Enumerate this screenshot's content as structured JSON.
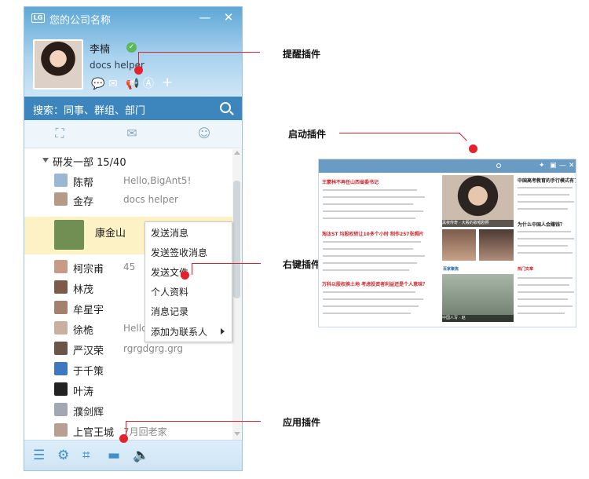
{
  "window": {
    "logo": "LG",
    "title": "您的公司名称",
    "minimize": "—",
    "close": "✕"
  },
  "profile": {
    "name": "李楠",
    "signature": "docs helper",
    "online_check": "✓",
    "icons": [
      "chat-bubble-icon",
      "mail-icon",
      "announce-icon",
      "font-icon",
      "add-icon"
    ]
  },
  "search": {
    "text": "搜索：同事、群组、部门"
  },
  "tabs": [
    {
      "name": "org-chart-icon",
      "glyph": "⛶"
    },
    {
      "name": "group-chat-icon",
      "glyph": "✉"
    },
    {
      "name": "recent-contacts-icon",
      "glyph": "☺"
    }
  ],
  "group": {
    "title": "研发一部  15/40"
  },
  "contacts": [
    {
      "name": "陈帮",
      "status": "Hello,BigAnt5!",
      "color": "#9ab7d4"
    },
    {
      "name": "金存",
      "status": "docs helper",
      "color": "#b59a86"
    },
    {
      "name": "康金山",
      "status": "",
      "color": "#6f8f53",
      "selected": true
    },
    {
      "name": "柯宗甫",
      "status": "45",
      "color": "#c79b85"
    },
    {
      "name": "林茂",
      "status": "",
      "color": "#7d5a4a"
    },
    {
      "name": "牟星宇",
      "status": "",
      "color": "#a5806c"
    },
    {
      "name": "徐桅",
      "status": "Hello",
      "color": "#c9b0a0"
    },
    {
      "name": "严汉荣",
      "status": "rgrgdgrg.grg",
      "color": "#6a5546"
    },
    {
      "name": "于千策",
      "status": "",
      "color": "#3f78c2"
    },
    {
      "name": "叶涛",
      "status": "",
      "color": "#222222"
    },
    {
      "name": "濮剑辉",
      "status": "",
      "color": "#9fa8b3"
    },
    {
      "name": "上官王城",
      "status": "7月回老家",
      "color": "#b7a092"
    }
  ],
  "context_menu": {
    "items": [
      "发送消息",
      "发送签收消息",
      "发送文件",
      "个人资料",
      "消息记录",
      "添加为联系人"
    ]
  },
  "bottom_bar": [
    "list-icon",
    "gear-icon",
    "crop-icon",
    "folder-icon",
    "volume-icon"
  ],
  "callouts": {
    "reminder": "提醒插件",
    "startup": "启动插件",
    "right_click": "右键插件",
    "app": "应用插件"
  },
  "preview": {
    "headlines": [
      "王蒙林不再任山西省委书记",
      "淘汰ST 均股权转让10多个小时 制作257张照片",
      "万科以股权换土地 考虑投资者利益还是个人意味？"
    ],
    "captions": [
      "黑夜传奇 · 大殿的歌唱剧照",
      "黑夜传奇",
      "中国人写 · 赵"
    ],
    "section_tags": [
      "百家聚焦",
      "热门文章"
    ],
    "right_heads": [
      "中国高考教育的手行模式有了吗？",
      "为什么中国人会赚钱？"
    ]
  },
  "colors": {
    "accent": "#3d86bd",
    "callout_red": "#e5222c",
    "selected_row": "#fdf1c6"
  }
}
